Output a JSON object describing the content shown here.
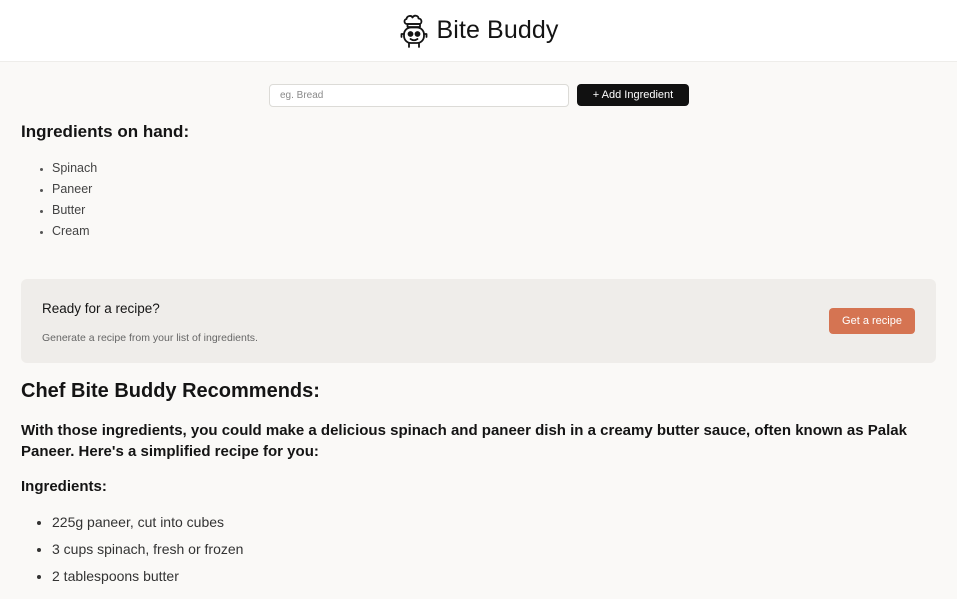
{
  "header": {
    "title": "Bite Buddy",
    "logo_icon": "chef-robot-icon"
  },
  "add_ingredient": {
    "placeholder": "eg. Bread",
    "value": "",
    "button_label": "+ Add Ingredient"
  },
  "ingredients_on_hand": {
    "heading": "Ingredients on hand:",
    "items": [
      "Spinach",
      "Paneer",
      "Butter",
      "Cream"
    ]
  },
  "recipe_card": {
    "title": "Ready for a recipe?",
    "subtitle": "Generate a recipe from your list of ingredients.",
    "button_label": "Get a recipe",
    "card_bg": "#efedea",
    "button_color": "#d57452"
  },
  "recommendation": {
    "heading": "Chef Bite Buddy Recommends:",
    "intro": "With those ingredients, you could make a delicious spinach and paneer dish in a creamy butter sauce, often known as Palak Paneer. Here's a simplified recipe for you:",
    "ingredients_heading": "Ingredients:",
    "ingredients": [
      "225g paneer, cut into cubes",
      "3 cups spinach, fresh or frozen",
      "2 tablespoons butter"
    ]
  }
}
